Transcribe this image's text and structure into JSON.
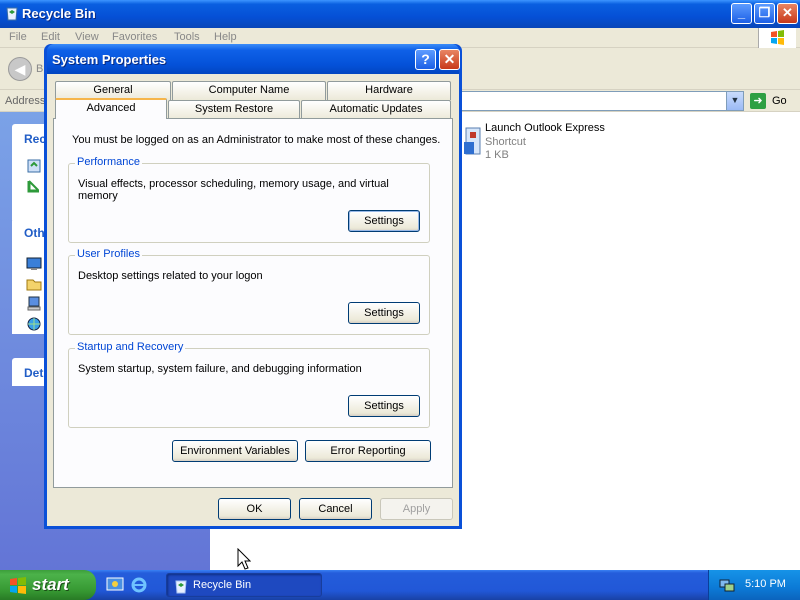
{
  "explorer": {
    "title": "Recycle Bin",
    "menu": [
      "File",
      "Edit",
      "View",
      "Favorites",
      "Tools",
      "Help"
    ],
    "back_label": "B",
    "address_label": "Address",
    "go_label": "Go",
    "taskpane_heads": [
      "Rec",
      "Oth",
      "Det"
    ],
    "file": {
      "name": "Launch Outlook Express",
      "type": "Shortcut",
      "size": "1 KB"
    }
  },
  "dialog": {
    "title": "System Properties",
    "tabs_top": [
      "General",
      "Computer Name",
      "Hardware"
    ],
    "tabs_bottom": [
      "Advanced",
      "System Restore",
      "Automatic Updates"
    ],
    "active_tab": "Advanced",
    "intro": "You must be logged on as an Administrator to make most of these changes.",
    "groups": [
      {
        "title": "Performance",
        "desc": "Visual effects, processor scheduling, memory usage, and virtual memory",
        "button": "Settings"
      },
      {
        "title": "User Profiles",
        "desc": "Desktop settings related to your logon",
        "button": "Settings"
      },
      {
        "title": "Startup and Recovery",
        "desc": "System startup, system failure, and debugging information",
        "button": "Settings"
      }
    ],
    "env_button": "Environment Variables",
    "error_button": "Error Reporting",
    "ok_button": "OK",
    "cancel_button": "Cancel",
    "apply_button": "Apply"
  },
  "taskbar": {
    "start_label": "start",
    "task_label": "Recycle Bin",
    "clock": "5:10 PM"
  },
  "colors": {
    "xp_blue": "#0550d6",
    "start_green": "#3c9e3b",
    "group_title": "#0046d5",
    "tab_highlight": "#f6b54a"
  }
}
